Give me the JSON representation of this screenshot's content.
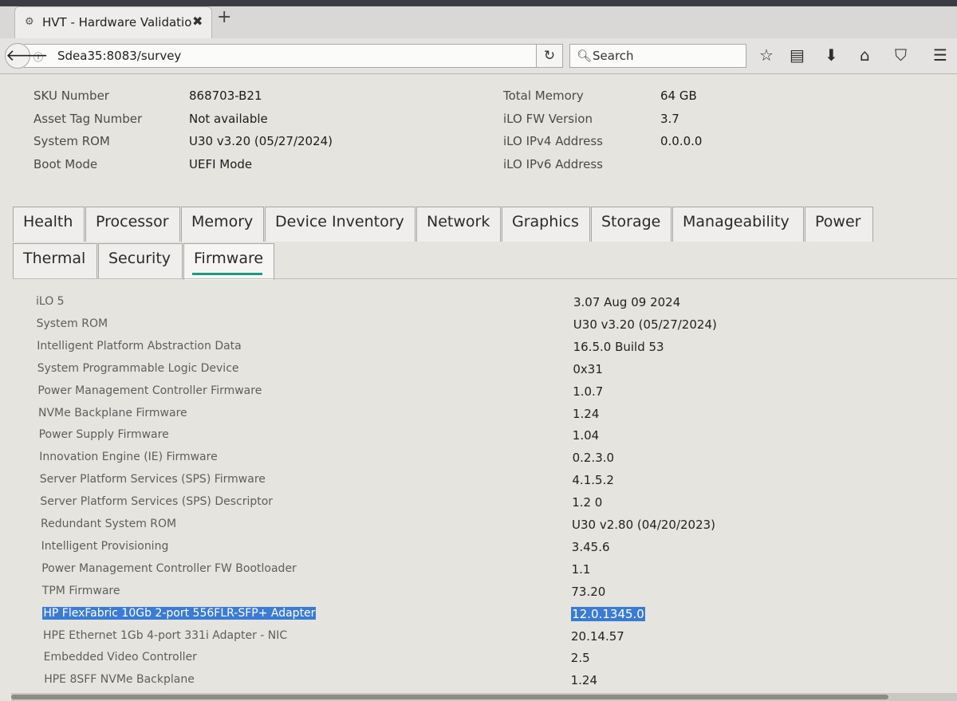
{
  "browser": {
    "tab_title": "HVT - Hardware Validatio",
    "tab_close": "✖",
    "new_tab": "+",
    "url": "Sdea35:8083/survey",
    "reload": "↻",
    "search_placeholder": "Search"
  },
  "system_info": {
    "left": [
      {
        "label": "SKU Number",
        "value": "868703-B21"
      },
      {
        "label": "Asset Tag Number",
        "value": "Not available"
      },
      {
        "label": "System ROM",
        "value": "U30 v3.20 (05/27/2024)"
      },
      {
        "label": "Boot Mode",
        "value": "UEFI Mode"
      }
    ],
    "right": [
      {
        "label": "Total Memory",
        "value": "64 GB"
      },
      {
        "label": "iLO FW Version",
        "value": "3.7"
      },
      {
        "label": "iLO IPv4 Address",
        "value": "0.0.0.0"
      },
      {
        "label": "iLO IPv6 Address",
        "value": ""
      }
    ]
  },
  "tabs_row1": [
    "Health",
    "Processor",
    "Memory",
    "Device Inventory",
    "Network",
    "Graphics",
    "Storage",
    "Manageability",
    "Power"
  ],
  "tabs_row2": [
    "Thermal",
    "Security",
    "Firmware"
  ],
  "active_tab": "Firmware",
  "firmware": [
    {
      "name": "iLO 5",
      "version": "3.07 Aug 09 2024"
    },
    {
      "name": "System ROM",
      "version": "U30 v3.20 (05/27/2024)"
    },
    {
      "name": "Intelligent Platform Abstraction Data",
      "version": "16.5.0 Build 53"
    },
    {
      "name": "System Programmable Logic Device",
      "version": "0x31"
    },
    {
      "name": "Power Management Controller Firmware",
      "version": "1.0.7"
    },
    {
      "name": "NVMe Backplane Firmware",
      "version": "1.24"
    },
    {
      "name": "Power Supply Firmware",
      "version": "1.04"
    },
    {
      "name": "Innovation Engine (IE) Firmware",
      "version": "0.2.3.0"
    },
    {
      "name": "Server Platform Services (SPS) Firmware",
      "version": "4.1.5.2"
    },
    {
      "name": "Server Platform Services (SPS) Descriptor",
      "version": "1.2 0"
    },
    {
      "name": "Redundant System ROM",
      "version": "U30 v2.80 (04/20/2023)"
    },
    {
      "name": "Intelligent Provisioning",
      "version": "3.45.6"
    },
    {
      "name": "Power Management Controller FW Bootloader",
      "version": "1.1"
    },
    {
      "name": "TPM Firmware",
      "version": "73.20"
    },
    {
      "name": "HP FlexFabric 10Gb 2-port 556FLR-SFP+ Adapter",
      "version": "12.0.1345.0"
    },
    {
      "name": "HPE Ethernet 1Gb 4-port 331i Adapter - NIC",
      "version": "20.14.57"
    },
    {
      "name": "Embedded Video Controller",
      "version": "2.5"
    },
    {
      "name": "HPE 8SFF NVMe Backplane",
      "version": "1.24"
    }
  ],
  "selected_row": 14,
  "colors": {
    "accent": "#1a9c84",
    "selection": "#3a7bd5"
  }
}
